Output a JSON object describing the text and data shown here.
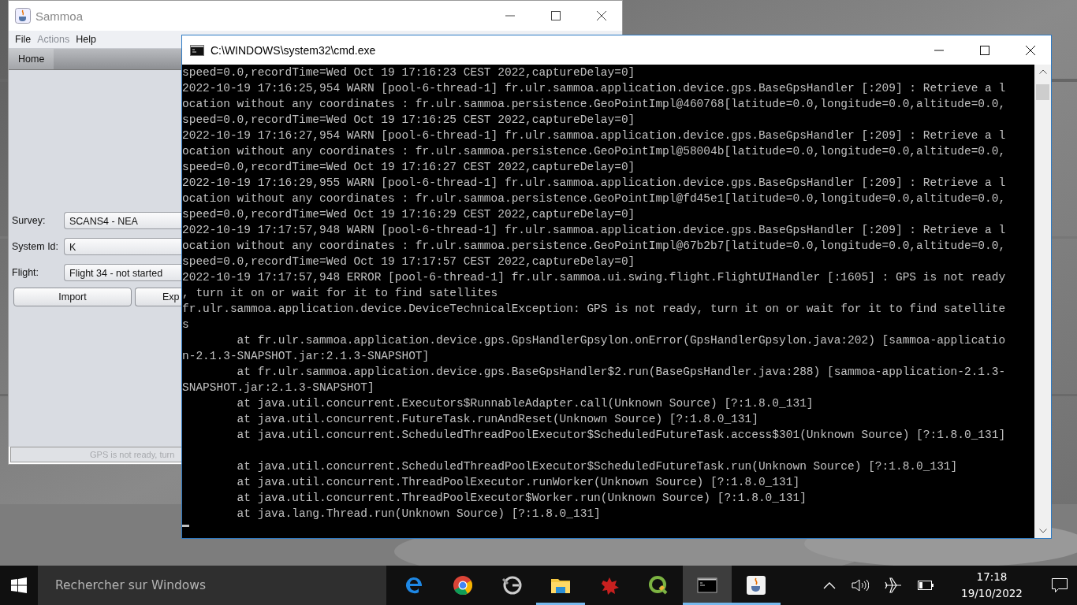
{
  "sammoa_window": {
    "title": "Sammoa",
    "menu": [
      {
        "label": "File",
        "disabled": false
      },
      {
        "label": "Actions",
        "disabled": true
      },
      {
        "label": "Help",
        "disabled": false
      }
    ],
    "tabs": [
      {
        "label": "Home",
        "selected": true
      }
    ],
    "form": [
      {
        "label": "Survey:",
        "value": "SCANS4 - NEA"
      },
      {
        "label": "System Id:",
        "value": "K"
      },
      {
        "label": "Flight:",
        "value": "Flight 34 - not started"
      }
    ],
    "buttons": [
      "Import",
      "Exp"
    ],
    "status_bar": "GPS is not ready, turn"
  },
  "console_window": {
    "title": "C:\\WINDOWS\\system32\\cmd.exe",
    "lines": [
      {
        "text": "speed=0.0,recordTime=Wed Oct 19 17:16:23 CEST 2022,captureDelay=0]"
      },
      {
        "text": "2022-10-19 17:16:25,954 WARN [pool-6-thread-1] fr.ulr.sammoa.application.device.gps.BaseGpsHandler [:209] : Retrieve a l"
      },
      {
        "text": "ocation without any coordinates : fr.ulr.sammoa.persistence.GeoPointImpl@460768[latitude=0.0,longitude=0.0,altitude=0.0,"
      },
      {
        "text": "speed=0.0,recordTime=Wed Oct 19 17:16:25 CEST 2022,captureDelay=0]"
      },
      {
        "text": "2022-10-19 17:16:27,954 WARN [pool-6-thread-1] fr.ulr.sammoa.application.device.gps.BaseGpsHandler [:209] : Retrieve a l"
      },
      {
        "text": "ocation without any coordinates : fr.ulr.sammoa.persistence.GeoPointImpl@58004b[latitude=0.0,longitude=0.0,altitude=0.0,"
      },
      {
        "text": "speed=0.0,recordTime=Wed Oct 19 17:16:27 CEST 2022,captureDelay=0]"
      },
      {
        "text": "2022-10-19 17:16:29,955 WARN [pool-6-thread-1] fr.ulr.sammoa.application.device.gps.BaseGpsHandler [:209] : Retrieve a l"
      },
      {
        "text": "ocation without any coordinates : fr.ulr.sammoa.persistence.GeoPointImpl@fd45e1[latitude=0.0,longitude=0.0,altitude=0.0,"
      },
      {
        "text": "speed=0.0,recordTime=Wed Oct 19 17:16:29 CEST 2022,captureDelay=0]"
      },
      {
        "text": "2022-10-19 17:17:57,948 WARN [pool-6-thread-1] fr.ulr.sammoa.application.device.gps.BaseGpsHandler [:209] : Retrieve a l"
      },
      {
        "text": "ocation without any coordinates : fr.ulr.sammoa.persistence.GeoPointImpl@67b2b7[latitude=0.0,longitude=0.0,altitude=0.0,"
      },
      {
        "text": "speed=0.0,recordTime=Wed Oct 19 17:17:57 CEST 2022,captureDelay=0]"
      },
      {
        "text": "2022-10-19 17:17:57,948 ERROR [pool-6-thread-1] fr.ulr.sammoa.ui.swing.flight.FlightUIHandler [:1605] : GPS is not ready"
      },
      {
        "text": ", turn it on or wait for it to find satellites"
      },
      {
        "text": "fr.ulr.sammoa.application.device.DeviceTechnicalException: GPS is not ready, turn it on or wait for it to find satellite"
      },
      {
        "text": "s"
      },
      {
        "text": "        at fr.ulr.sammoa.application.device.gps.GpsHandlerGpsylon.onError(GpsHandlerGpsylon.java:202) [sammoa-applicatio"
      },
      {
        "text": "n-2.1.3-SNAPSHOT.jar:2.1.3-SNAPSHOT]"
      },
      {
        "text": "        at fr.ulr.sammoa.application.device.gps.BaseGpsHandler$2.run(BaseGpsHandler.java:288) [sammoa-application-2.1.3-"
      },
      {
        "text": "SNAPSHOT.jar:2.1.3-SNAPSHOT]"
      },
      {
        "text": "        at java.util.concurrent.Executors$RunnableAdapter.call(Unknown Source) [?:1.8.0_131]"
      },
      {
        "text": "        at java.util.concurrent.FutureTask.runAndReset(Unknown Source) [?:1.8.0_131]"
      },
      {
        "text": "        at java.util.concurrent.ScheduledThreadPoolExecutor$ScheduledFutureTask.access$301(Unknown Source) [?:1.8.0_131]"
      },
      {
        "text": "        at java.util.concurrent.ScheduledThreadPoolExecutor$ScheduledFutureTask.run(Unknown Source) [?:1.8.0_131]",
        "blank_line_before": true
      },
      {
        "text": "        at java.util.concurrent.ThreadPoolExecutor.runWorker(Unknown Source) [?:1.8.0_131]"
      },
      {
        "text": "        at java.util.concurrent.ThreadPoolExecutor$Worker.run(Unknown Source) [?:1.8.0_131]"
      },
      {
        "text": "        at java.lang.Thread.run(Unknown Source) [?:1.8.0_131]"
      }
    ]
  },
  "taskbar": {
    "search": {
      "placeholder": "Rechercher sur Windows"
    },
    "apps": [
      {
        "kind": "edge",
        "running": false,
        "selected": false
      },
      {
        "kind": "chrome",
        "running": false,
        "selected": false
      },
      {
        "kind": "gtool",
        "running": false,
        "selected": false
      },
      {
        "kind": "folder",
        "running": true,
        "selected": false
      },
      {
        "kind": "splat",
        "running": false,
        "selected": false
      },
      {
        "kind": "qgis",
        "running": false,
        "selected": false
      },
      {
        "kind": "terminal",
        "running": true,
        "selected": true
      },
      {
        "kind": "java",
        "running": true,
        "selected": false
      }
    ],
    "clock": {
      "time": "17:18",
      "date": "19/10/2022"
    }
  }
}
